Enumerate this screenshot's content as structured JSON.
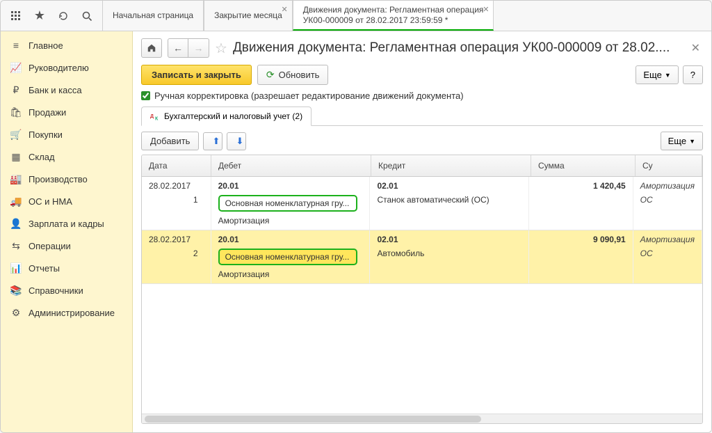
{
  "topbar": {
    "tabs": [
      {
        "label": "Начальная страница"
      },
      {
        "label": "Закрытие месяца"
      },
      {
        "line1": "Движения документа: Регламентная операция",
        "line2": "УК00-000009 от 28.02.2017 23:59:59 *"
      }
    ]
  },
  "sidebar": {
    "items": [
      {
        "icon": "menu-icon",
        "label": "Главное"
      },
      {
        "icon": "chart-icon",
        "label": "Руководителю"
      },
      {
        "icon": "ruble-icon",
        "label": "Банк и касса"
      },
      {
        "icon": "bag-icon",
        "label": "Продажи"
      },
      {
        "icon": "cart-icon",
        "label": "Покупки"
      },
      {
        "icon": "boxes-icon",
        "label": "Склад"
      },
      {
        "icon": "factory-icon",
        "label": "Производство"
      },
      {
        "icon": "truck-icon",
        "label": "ОС и НМА"
      },
      {
        "icon": "person-icon",
        "label": "Зарплата и кадры"
      },
      {
        "icon": "ops-icon",
        "label": "Операции"
      },
      {
        "icon": "reports-icon",
        "label": "Отчеты"
      },
      {
        "icon": "books-icon",
        "label": "Справочники"
      },
      {
        "icon": "gear-icon",
        "label": "Администрирование"
      }
    ]
  },
  "page": {
    "title": "Движения документа: Регламентная операция УК00-000009 от 28.02....",
    "save_close": "Записать и закрыть",
    "refresh": "Обновить",
    "more": "Еще",
    "help": "?",
    "manual_edit_label": "Ручная корректировка (разрешает редактирование движений документа)",
    "inner_tab": "Бухгалтерский и налоговый учет (2)",
    "add": "Добавить",
    "columns": {
      "date": "Дата",
      "debit": "Дебет",
      "credit": "Кредит",
      "sum": "Сумма",
      "ext": "Су"
    },
    "rows": [
      {
        "date": "28.02.2017",
        "num": "1",
        "debit_acc": "20.01",
        "debit_group": "Основная номенклатурная гру...",
        "debit_extra": "Амортизация",
        "credit_acc": "02.01",
        "credit_name": "Станок автоматический (ОС)",
        "sum": "1 420,45",
        "note1": "Амортизация",
        "note2": "ОС"
      },
      {
        "date": "28.02.2017",
        "num": "2",
        "debit_acc": "20.01",
        "debit_group": "Основная номенклатурная гру...",
        "debit_extra": "Амортизация",
        "credit_acc": "02.01",
        "credit_name": "Автомобиль",
        "sum": "9 090,91",
        "note1": "Амортизация",
        "note2": "ОС"
      }
    ]
  }
}
